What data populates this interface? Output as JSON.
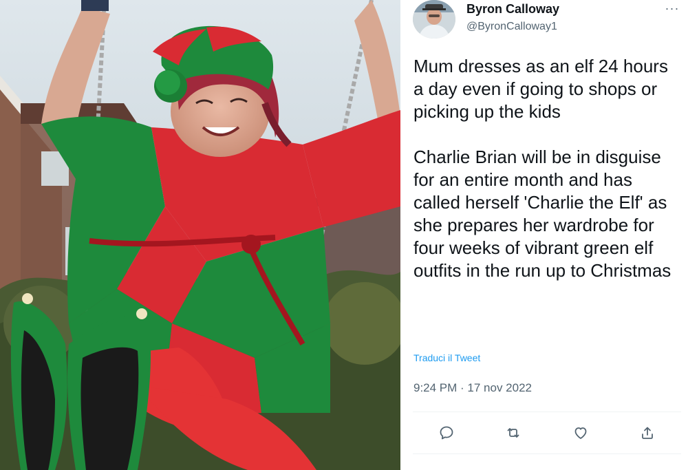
{
  "tweet": {
    "display_name": "Byron Calloway",
    "handle": "@ByronCalloway1",
    "more_label": "···",
    "body": "Mum dresses as an elf 24 hours a day even if going to shops or picking up the kids\n\nCharlie Brian will be in disguise for an entire month and has called herself 'Charlie the Elf' as she prepares her wardrobe for four weeks of vibrant green elf outfits in the run up to Christmas",
    "translate_label": "Traduci il Tweet",
    "timestamp": "9:24 PM · 17 nov 2022"
  },
  "actions": [
    {
      "icon": "reply-icon"
    },
    {
      "icon": "retweet-icon"
    },
    {
      "icon": "like-icon"
    },
    {
      "icon": "share-icon"
    }
  ],
  "colors": {
    "text_primary": "#0f1419",
    "text_secondary": "#536471",
    "link": "#1d9bf0",
    "divider": "#eff3f4",
    "elf_red": "#d92b33",
    "elf_green": "#1e8a3c"
  }
}
